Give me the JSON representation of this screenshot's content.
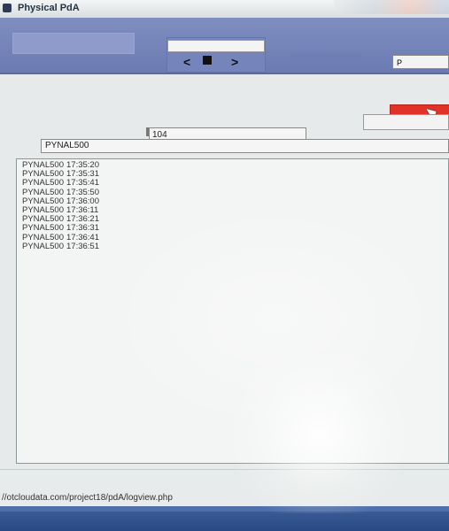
{
  "window": {
    "title": "Physical PdA"
  },
  "header": {
    "nav_prev": "<",
    "nav_next": ">",
    "right_field_value": "P"
  },
  "form": {
    "count_value": "104",
    "code_value": "PYNAL500"
  },
  "log": {
    "items": [
      {
        "code": "PYNAL500",
        "time": "17:35:20"
      },
      {
        "code": "PYNAL500",
        "time": "17:35:31"
      },
      {
        "code": "PYNAL500",
        "time": "17:35:41"
      },
      {
        "code": "PYNAL500",
        "time": "17:35:50"
      },
      {
        "code": "PYNAL500",
        "time": "17:36:00"
      },
      {
        "code": "PYNAL500",
        "time": "17:36:11"
      },
      {
        "code": "PYNAL500",
        "time": "17:36:21"
      },
      {
        "code": "PYNAL500",
        "time": "17:36:31"
      },
      {
        "code": "PYNAL500",
        "time": "17:36:41"
      },
      {
        "code": "PYNAL500",
        "time": "17:36:51"
      }
    ]
  },
  "status": {
    "url": "//otcloudata.com/project18/pdA/logview.php"
  },
  "colors": {
    "header": "#7381b8",
    "accent_button": "#e03228",
    "taskbar": "#2f4f8c"
  },
  "icons": {
    "app": "app-icon",
    "cursor": "mouse-cursor-icon",
    "nav_stop": "stop-square-icon"
  }
}
